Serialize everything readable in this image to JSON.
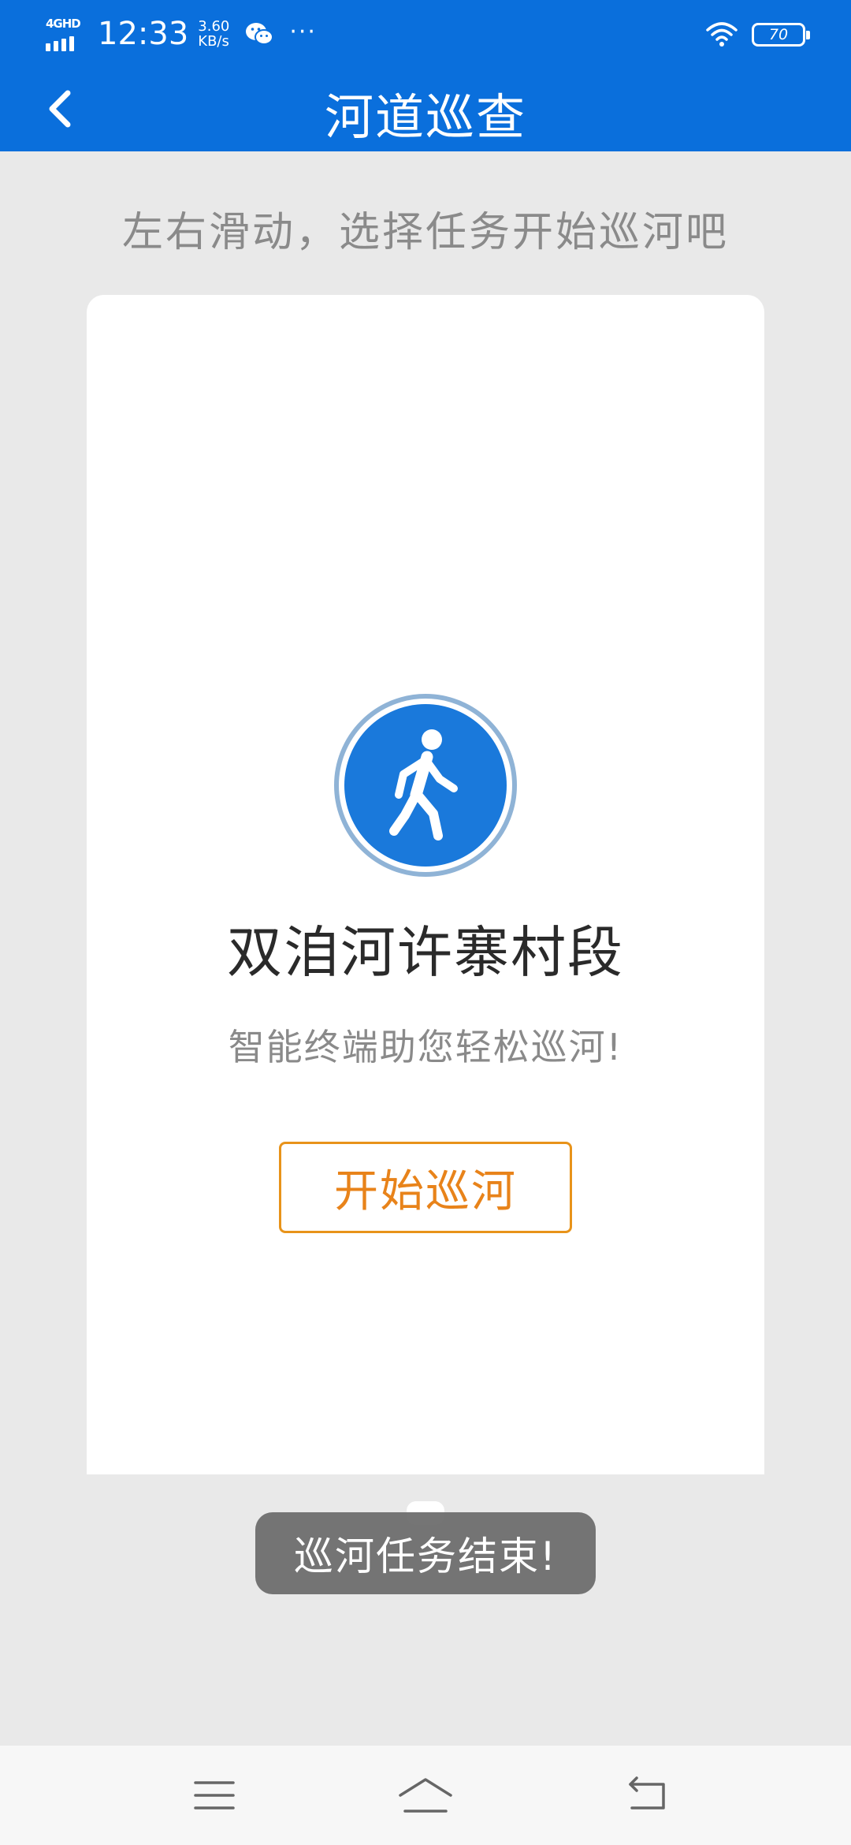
{
  "status_bar": {
    "network": "4GHD",
    "time": "12:33",
    "net_speed_value": "3.60",
    "net_speed_unit": "KB/s",
    "more": "···",
    "battery": "70"
  },
  "header": {
    "title": "河道巡查"
  },
  "instruction": "左右滑动，选择任务开始巡河吧",
  "task_card": {
    "name": "双洎河许寨村段",
    "subtitle": "智能终端助您轻松巡河!",
    "start_label": "开始巡河"
  },
  "toast": "巡河任务结束!",
  "colors": {
    "primary_blue": "#0a6fdc",
    "accent_orange": "#e8931a",
    "icon_blue": "#1a79db"
  }
}
